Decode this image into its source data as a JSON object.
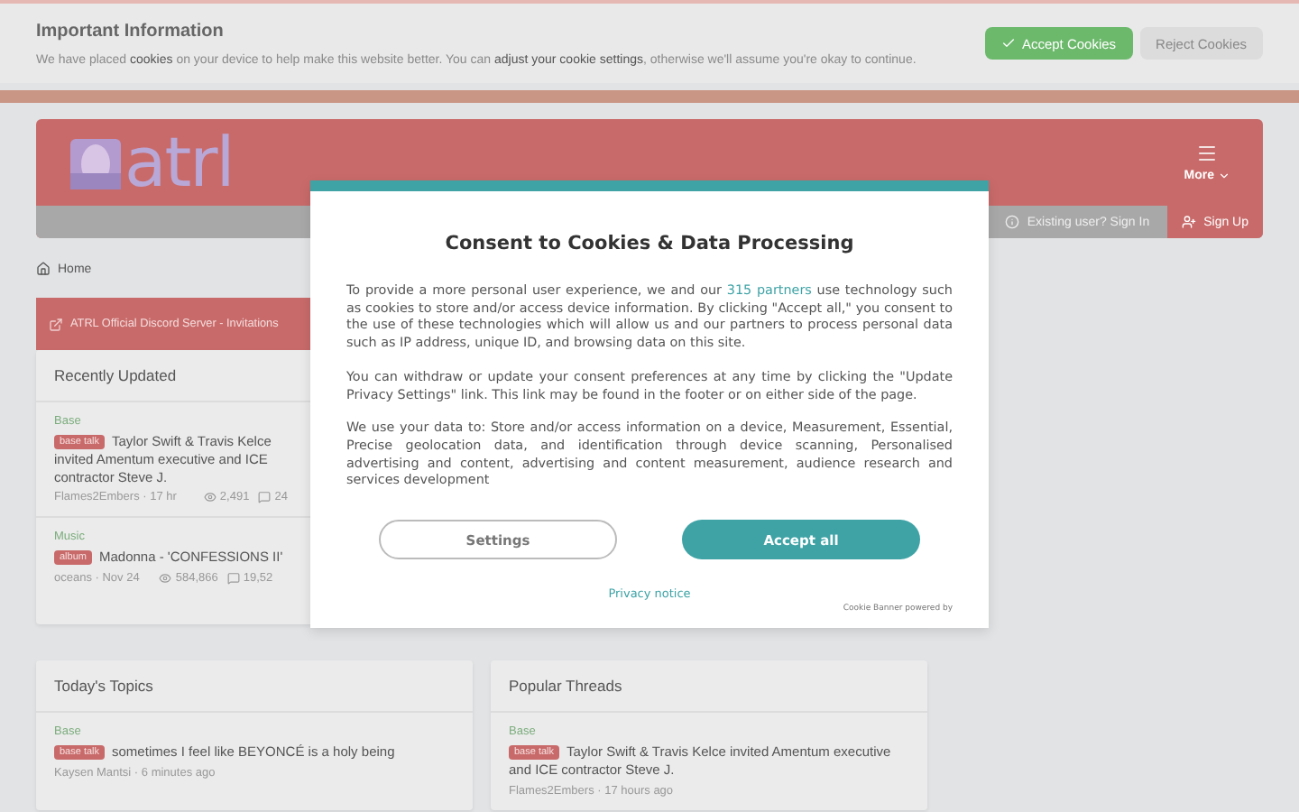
{
  "notice_banner": {
    "title": "Important Information",
    "text": "We have placed **cookies** on your device to help make this website better. You can **adjust your cookie settings**, otherwise we'll assume you're okay to continue.",
    "buttons": [
      {
        "label": "Accept Cookies",
        "kind": "primary"
      },
      {
        "label": "Reject Cookies",
        "kind": "secondary"
      }
    ]
  },
  "header": {
    "logo": "atrl",
    "more": "More",
    "sign_in": "Existing user? Sign In",
    "sign_up": "Sign Up"
  },
  "breadcrumb": "Home",
  "announcement": "ATRL Official Discord Server - Invitations",
  "recently_updated": {
    "title": "Recently Updated",
    "items": [
      {
        "forum": "Base",
        "tag": "base talk",
        "title": "Taylor Swift & Travis Kelce invited Amentum executive and ICE contractor Steve J.",
        "meta": "Flames2Embers · 17 hr",
        "views": "2,491",
        "replies": "24"
      },
      {
        "forum": "Music",
        "tag": "album",
        "title": "Madonna - 'CONFESSIONS II'",
        "meta": "oceans · Nov 24",
        "views": "584,866",
        "replies": "19,52"
      }
    ]
  },
  "cards": [
    {
      "title": "Today's Topics",
      "items": [
        {
          "forum": "Base",
          "tag": "base talk",
          "title": "sometimes I feel like BEYONCÉ is a holy being",
          "meta": "Kaysen Mantsi · 6 minutes ago"
        }
      ]
    },
    {
      "title": "Popular Threads",
      "items": [
        {
          "forum": "Base",
          "tag": "base talk",
          "title": "Taylor Swift & Travis Kelce invited Amentum executive and ICE contractor Steve J.",
          "meta": "Flames2Embers · 17 hours ago"
        }
      ]
    }
  ],
  "consent_dialog": {
    "title": "Consent to Cookies & Data Processing",
    "intro": {
      "before": "To provide a more personal user experience, we and our",
      "link": "315 partners",
      "after": "use technology such as cookies to store and/or access device information. By clicking \"Accept all,\" you consent to the use of these technologies which will allow us and our partners to process personal data such as IP address, unique ID, and browsing data on this site."
    },
    "paragraphs": [
      "You can withdraw or update your consent preferences at any time by clicking the \"Update Privacy Settings\" link. This link may be found in the footer or on either side of the page.",
      "We use your data to: Store and/or access information on a device, Measurement, Essential, Precise geolocation data, and identification through device scanning, Personalised advertising and content, advertising and content measurement, audience research and services development"
    ],
    "buttons": [
      {
        "label": "Settings",
        "kind": "outline"
      },
      {
        "label": "Accept all",
        "kind": "filled"
      }
    ],
    "privacy_link": "Privacy notice",
    "powered_by": "Cookie Banner powered by"
  }
}
